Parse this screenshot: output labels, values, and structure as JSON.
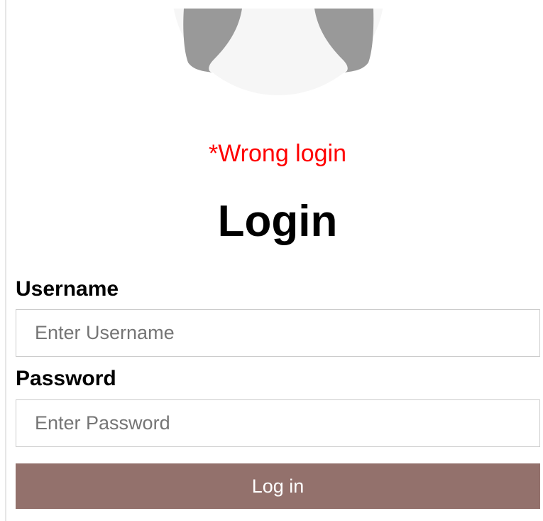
{
  "avatar": {
    "icon": "user-avatar-icon",
    "colors": {
      "background": "#f6f6f6",
      "figure": "#999999"
    }
  },
  "error_message": "*Wrong login",
  "form": {
    "title": "Login",
    "username": {
      "label": "Username",
      "placeholder": "Enter Username",
      "value": ""
    },
    "password": {
      "label": "Password",
      "placeholder": "Enter Password",
      "value": ""
    },
    "submit_label": "Log in"
  },
  "colors": {
    "error": "#ff0000",
    "button": "#93716c",
    "button_text": "#ffffff",
    "input_border": "#cccccc"
  }
}
